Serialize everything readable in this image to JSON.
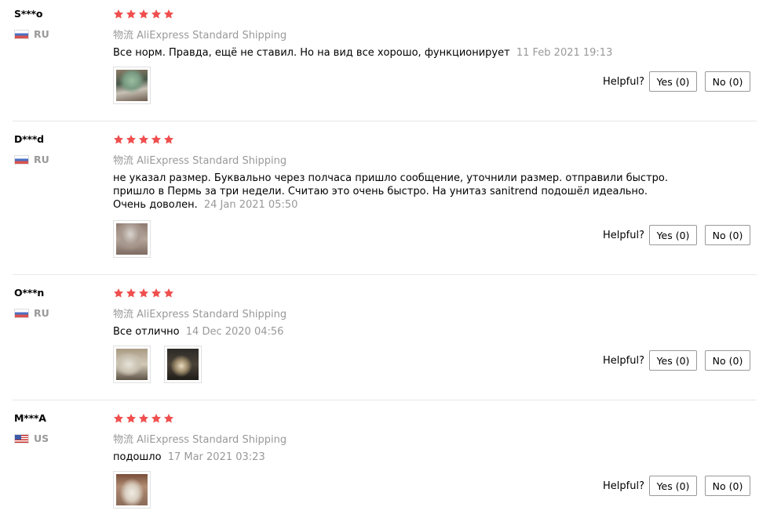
{
  "helpful_label": "Helpful?",
  "star_color": "#f04f4f",
  "reviews": [
    {
      "username": "S***o",
      "country": "RU",
      "flag": "russia-flag",
      "rating": 5,
      "shipping_prefix": "物流",
      "shipping_method": "AliExpress Standard Shipping",
      "text": "Все норм. Правда, ещё не ставил. Но на вид все хорошо, функционирует",
      "date": "11 Feb 2021 19:13",
      "photos": [
        "review-photo"
      ],
      "yes_label": "Yes (0)",
      "no_label": "No (0)"
    },
    {
      "username": "D***d",
      "country": "RU",
      "flag": "russia-flag",
      "rating": 5,
      "shipping_prefix": "物流",
      "shipping_method": "AliExpress Standard Shipping",
      "text": "не указал размер. Буквально через полчаса пришло сообщение, уточнили размер. отправили быстро. пришло в Пермь за три недели. Считаю это очень быстро. На унитаз sanitrend подошёл идеально. Очень доволен.",
      "date": "24 Jan 2021 05:50",
      "photos": [
        "review-photo"
      ],
      "yes_label": "Yes (0)",
      "no_label": "No (0)"
    },
    {
      "username": "O***n",
      "country": "RU",
      "flag": "russia-flag",
      "rating": 5,
      "shipping_prefix": "物流",
      "shipping_method": "AliExpress Standard Shipping",
      "text": "Все отлично",
      "date": "14 Dec 2020 04:56",
      "photos": [
        "review-photo",
        "review-photo"
      ],
      "yes_label": "Yes (0)",
      "no_label": "No (0)"
    },
    {
      "username": "M***A",
      "country": "US",
      "flag": "usa-flag",
      "rating": 5,
      "shipping_prefix": "物流",
      "shipping_method": "AliExpress Standard Shipping",
      "text": "подошло",
      "date": "17 Mar 2021 03:23",
      "photos": [
        "review-photo"
      ],
      "yes_label": "Yes (0)",
      "no_label": "No (0)"
    }
  ]
}
